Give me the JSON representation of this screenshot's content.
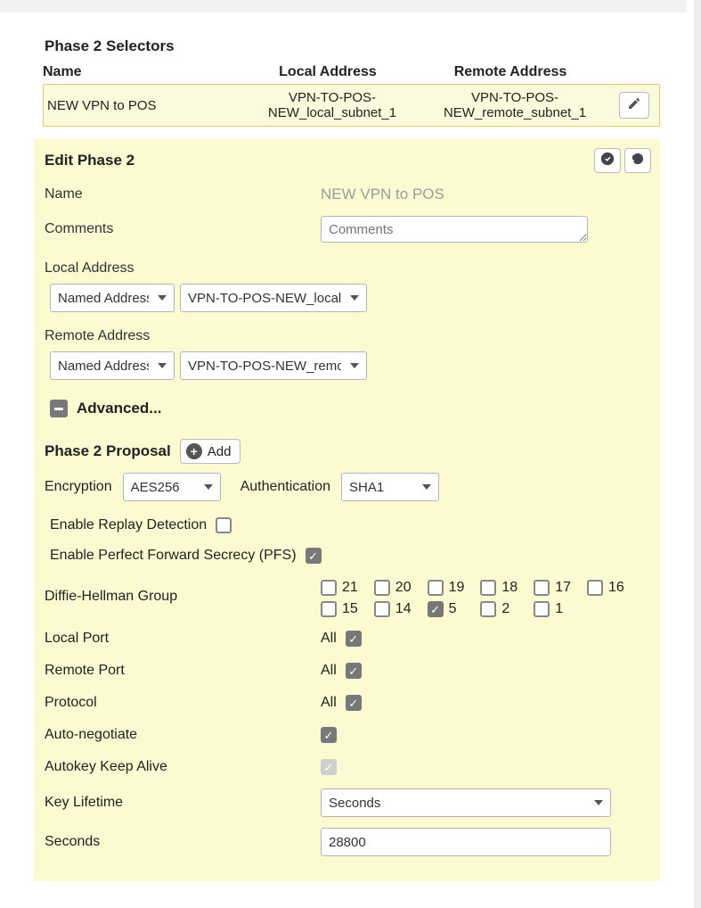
{
  "selectors": {
    "title": "Phase 2 Selectors",
    "columns": {
      "name": "Name",
      "local": "Local Address",
      "remote": "Remote Address"
    },
    "rows": [
      {
        "name": "NEW VPN to POS",
        "local": "VPN-TO-POS-NEW_local_subnet_1",
        "remote": "VPN-TO-POS-NEW_remote_subnet_1"
      }
    ]
  },
  "edit": {
    "title": "Edit Phase 2",
    "labels": {
      "name": "Name",
      "comments": "Comments",
      "local_addr": "Local Address",
      "remote_addr": "Remote Address",
      "advanced": "Advanced...",
      "proposal": "Phase 2 Proposal",
      "add": "Add",
      "encryption": "Encryption",
      "authentication": "Authentication",
      "replay": "Enable Replay Detection",
      "pfs": "Enable Perfect Forward Secrecy (PFS)",
      "dh": "Diffie-Hellman Group",
      "local_port": "Local Port",
      "remote_port": "Remote Port",
      "protocol": "Protocol",
      "autoneg": "Auto-negotiate",
      "keepalive": "Autokey Keep Alive",
      "keylife": "Key Lifetime",
      "seconds": "Seconds"
    },
    "name_value": "NEW VPN to POS",
    "comments_placeholder": "Comments",
    "addr_mode": "Named Address",
    "local_sel": "VPN-TO-POS-NEW_local_subnet_1",
    "remote_sel": "VPN-TO-POS-NEW_remote_subnet_1",
    "encryption_value": "AES256",
    "auth_value": "SHA1",
    "replay_checked": false,
    "pfs_checked": true,
    "dh_groups": [
      {
        "label": "21",
        "checked": false
      },
      {
        "label": "20",
        "checked": false
      },
      {
        "label": "19",
        "checked": false
      },
      {
        "label": "18",
        "checked": false
      },
      {
        "label": "17",
        "checked": false
      },
      {
        "label": "16",
        "checked": false
      },
      {
        "label": "15",
        "checked": false
      },
      {
        "label": "14",
        "checked": false
      },
      {
        "label": "5",
        "checked": true
      },
      {
        "label": "2",
        "checked": false
      },
      {
        "label": "1",
        "checked": false
      }
    ],
    "ports": {
      "all_text": "All",
      "local_all": true,
      "remote_all": true,
      "protocol_all": true
    },
    "autoneg_checked": true,
    "keepalive_checked": true,
    "keylife_value": "Seconds",
    "seconds_value": "28800"
  }
}
